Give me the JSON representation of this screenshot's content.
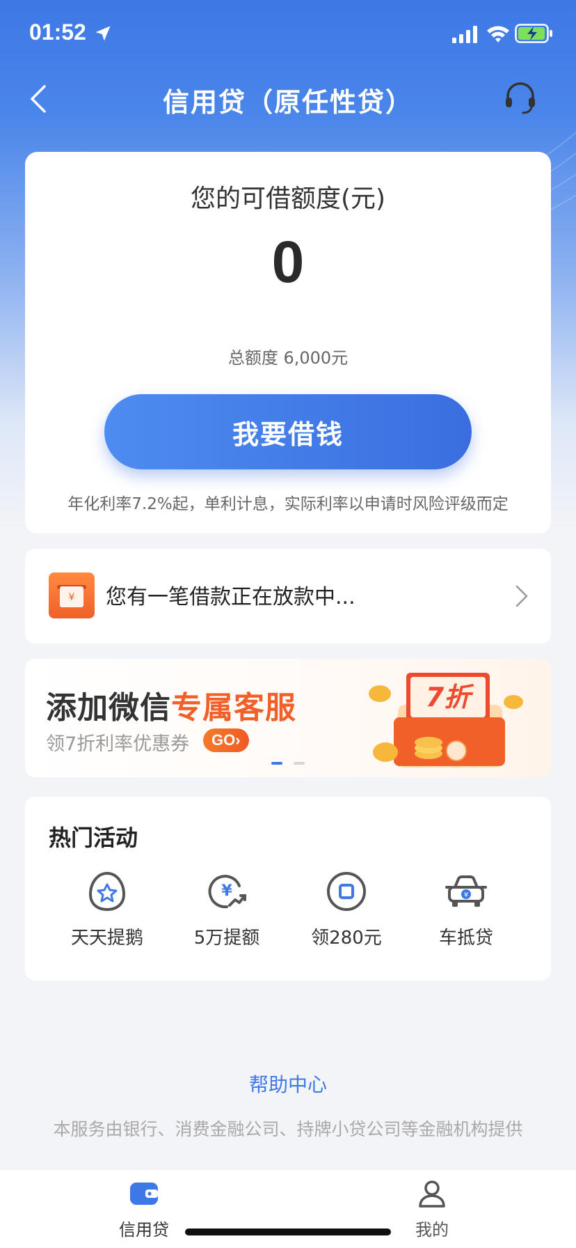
{
  "status_bar": {
    "time": "01:52"
  },
  "nav": {
    "title": "信用贷（原任性贷）"
  },
  "credit": {
    "label": "您的可借额度(元)",
    "amount": "0",
    "total_limit": "总额度 6,000元",
    "borrow_button": "我要借钱",
    "rate_note": "年化利率7.2%起，单利计息，实际利率以申请时风险评级而定"
  },
  "notice": {
    "text": "您有一笔借款正在放款中..."
  },
  "banner": {
    "title_prefix": "添加微信",
    "title_highlight": "专属客服",
    "subtitle": "领7折利率优惠券",
    "go_label": "GO›",
    "badge": "7折"
  },
  "activities": {
    "title": "热门活动",
    "items": [
      {
        "label": "天天提鹅",
        "icon": "star-badge-icon"
      },
      {
        "label": "5万提额",
        "icon": "yuan-growth-icon"
      },
      {
        "label": "领280元",
        "icon": "coupon-icon"
      },
      {
        "label": "车抵贷",
        "icon": "car-icon"
      }
    ]
  },
  "footer": {
    "help_center": "帮助中心",
    "disclaimer": "本服务由银行、消费金融公司、持牌小贷公司等金融机构提供"
  },
  "tabbar": {
    "items": [
      {
        "label": "信用贷",
        "active": true
      },
      {
        "label": "我的",
        "active": false
      }
    ]
  },
  "colors": {
    "primary": "#3d78e6",
    "accent_orange": "#f2602a",
    "background": "#f3f4f7"
  }
}
